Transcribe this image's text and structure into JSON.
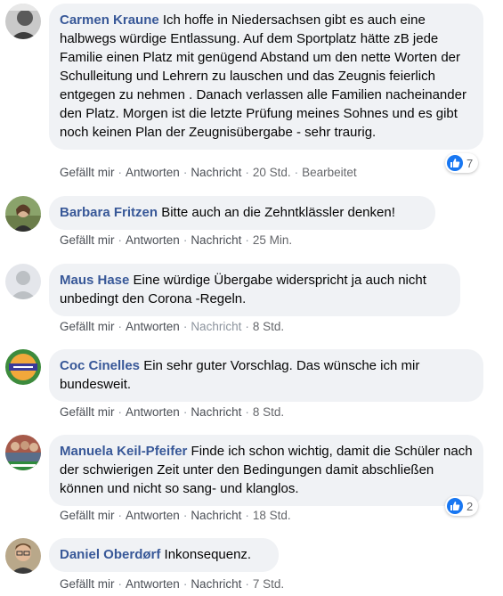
{
  "comments": [
    {
      "author": "Carmen Kraune",
      "text": " Ich hoffe in Niedersachsen gibt es auch eine halbwegs würdige Entlassung. Auf dem Sportplatz hätte zB jede Familie einen Platz mit genügend Abstand um den nette Worten der Schulleitung und Lehrern zu lauschen und das Zeugnis feierlich entgegen zu nehmen . Danach verlassen alle Familien nacheinander den Platz. Morgen ist die letzte Prüfung meines Sohnes und es gibt noch keinen Plan der Zeugnisübergabe - sehr traurig.",
      "like": "Gefällt mir",
      "reply": "Antworten",
      "message": "Nachricht",
      "time": "20 Std.",
      "edited": "Bearbeitet",
      "reactions": "7"
    },
    {
      "author": "Barbara Fritzen",
      "text": " Bitte auch an die Zehntklässler denken!",
      "like": "Gefällt mir",
      "reply": "Antworten",
      "message": "Nachricht",
      "time": "25 Min."
    },
    {
      "author": "Maus Hase",
      "text": " Eine würdige Übergabe widerspricht ja auch nicht unbedingt den Corona -Regeln.",
      "like": "Gefällt mir",
      "reply": "Antworten",
      "message": "Nachricht",
      "time": "8 Std."
    },
    {
      "author": "Coc Cinelles",
      "text": " Ein sehr guter Vorschlag. Das wünsche ich mir bundesweit.",
      "like": "Gefällt mir",
      "reply": "Antworten",
      "message": "Nachricht",
      "time": "8 Std."
    },
    {
      "author": "Manuela Keil-Pfeifer",
      "text": " Finde ich schon wichtig, damit die Schüler nach der schwierigen Zeit unter den Bedingungen damit abschließen können und nicht so sang- und klanglos.",
      "like": "Gefällt mir",
      "reply": "Antworten",
      "message": "Nachricht",
      "time": "18 Std.",
      "reactions": "2"
    },
    {
      "author": "Daniel Oberdørf",
      "text": " Inkonsequenz.",
      "like": "Gefällt mir",
      "reply": "Antworten",
      "message": "Nachricht",
      "time": "7 Std."
    }
  ],
  "colors": {
    "author": "#385898",
    "bubble": "#f0f2f5",
    "like_blue": "#1877f2",
    "meta": "#65676b"
  },
  "icons": {
    "reaction": "thumbs-up-icon",
    "avatar_default": "default-avatar-icon"
  }
}
